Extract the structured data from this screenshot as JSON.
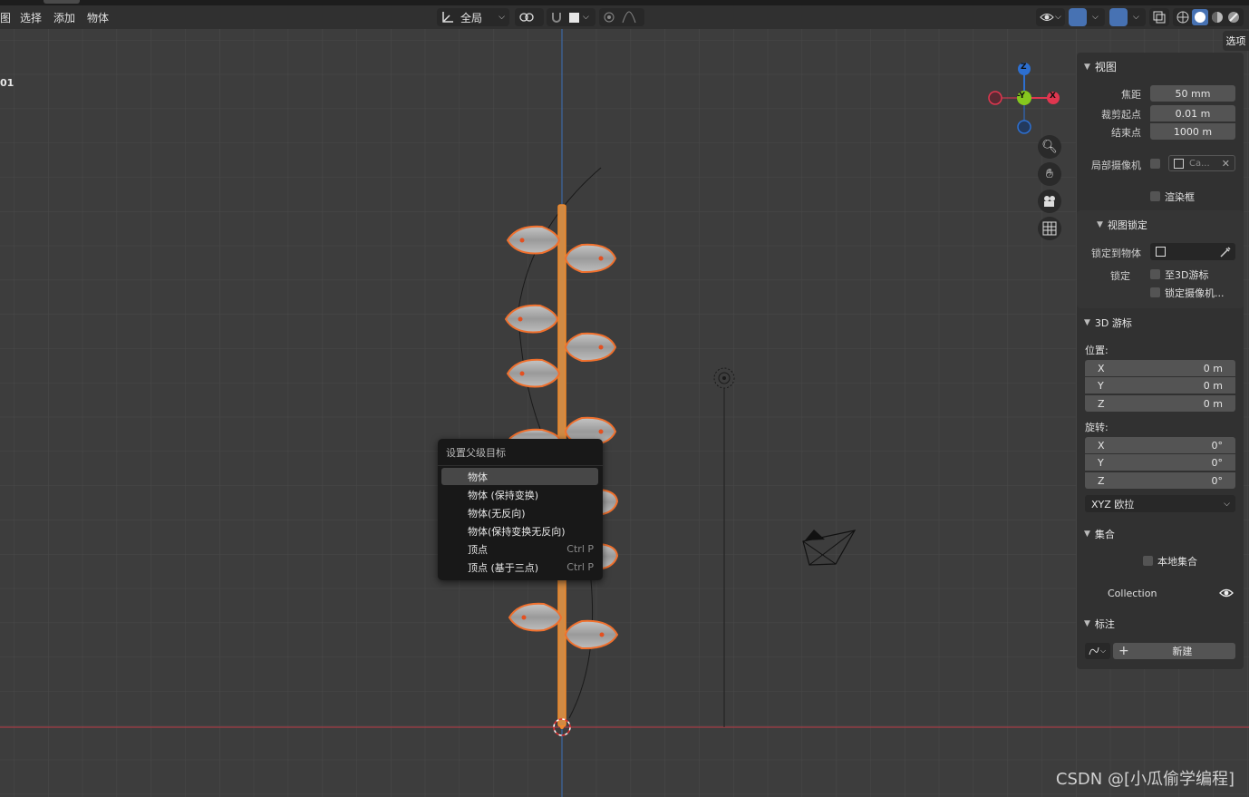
{
  "menus": {
    "left_cut": "图",
    "select": "选择",
    "add": "添加",
    "object": "物体"
  },
  "header": {
    "transform_orientation": "全局",
    "options_tab": "选项"
  },
  "viewport": {
    "left_label": "01"
  },
  "gizmo": {
    "z": "Z",
    "y": "-Y",
    "x": "X"
  },
  "context_menu": {
    "title": "设置父级目标",
    "items": [
      {
        "label": "物体",
        "shortcut": ""
      },
      {
        "label": "物体 (保持变换)",
        "shortcut": ""
      },
      {
        "label": "物体(无反向)",
        "shortcut": ""
      },
      {
        "label": "物体(保持变换无反向)",
        "shortcut": ""
      },
      {
        "label": "顶点",
        "shortcut": "Ctrl P"
      },
      {
        "label": "顶点 (基于三点)",
        "shortcut": "Ctrl P"
      }
    ]
  },
  "sidebar": {
    "view": {
      "title": "视图",
      "focal_label": "焦距",
      "focal_value": "50 mm",
      "clip_start_label": "裁剪起点",
      "clip_start_value": "0.01 m",
      "clip_end_label": "结束点",
      "clip_end_value": "1000 m",
      "local_camera_label": "局部摄像机",
      "local_camera_value": "Ca...",
      "render_region": "渲染框"
    },
    "view_lock": {
      "title": "视图锁定",
      "lock_to_object": "锁定到物体",
      "lock_label": "锁定",
      "to_3d_cursor": "至3D游标",
      "lock_camera": "锁定摄像机..."
    },
    "cursor3d": {
      "title": "3D 游标",
      "location_label": "位置:",
      "location": [
        {
          "axis": "X",
          "value": "0 m"
        },
        {
          "axis": "Y",
          "value": "0 m"
        },
        {
          "axis": "Z",
          "value": "0 m"
        }
      ],
      "rotation_label": "旋转:",
      "rotation": [
        {
          "axis": "X",
          "value": "0°"
        },
        {
          "axis": "Y",
          "value": "0°"
        },
        {
          "axis": "Z",
          "value": "0°"
        }
      ],
      "rotation_mode": "XYZ 欧拉"
    },
    "collection": {
      "title": "集合",
      "local_collection": "本地集合",
      "collection_name": "Collection"
    },
    "annotation": {
      "title": "标注",
      "new_button": "新建"
    }
  },
  "watermark": "CSDN @[小瓜偷学编程]",
  "colors": {
    "accent_orange": "#f0892d",
    "axis_red": "#b8404a",
    "axis_blue": "#3b6aa8",
    "gizmo_x": "#e0364f",
    "gizmo_y": "#86c81e",
    "gizmo_z": "#2d6fd0"
  }
}
